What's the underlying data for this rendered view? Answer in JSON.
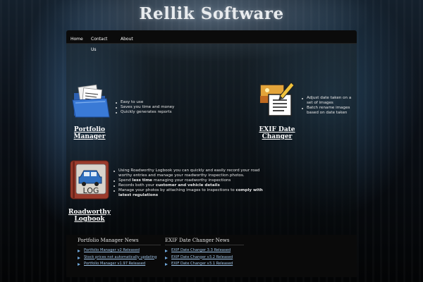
{
  "site": {
    "logo": "Rellik Software"
  },
  "nav": {
    "items": [
      {
        "label": "Home"
      },
      {
        "label": "Contact Us"
      },
      {
        "label": "About"
      }
    ]
  },
  "products": {
    "portfolio": {
      "title": "Portfolio Manager",
      "features": [
        "Easy to use",
        "Saves you time and money",
        "Quickly generates reports"
      ]
    },
    "exif": {
      "title": "EXIF Date Changer",
      "features": [
        "Adjust date taken on a set of images",
        "Batch rename images based on date taken"
      ]
    },
    "roadworthy": {
      "title": "Roadworthy Logbook",
      "icon_text": "LOG",
      "features": [
        {
          "parts": [
            {
              "text": "Using Roadworthy Logbook you can quickly and easily record your road worthy entries and manage your roadworthy inspection photos."
            }
          ]
        },
        {
          "parts": [
            {
              "text": "Spend "
            },
            {
              "text": "less time",
              "bold": true
            },
            {
              "text": " managing your roadworthy inspections"
            }
          ]
        },
        {
          "parts": [
            {
              "text": "Records both your "
            },
            {
              "text": "customer and vehicle details",
              "bold": true
            }
          ]
        },
        {
          "parts": [
            {
              "text": "Manage your photos by attaching images to inspections to "
            },
            {
              "text": "comply with latest regulations",
              "bold": true
            }
          ]
        }
      ]
    }
  },
  "news": {
    "portfolio": {
      "heading": "Portfolio Manager News",
      "items": [
        "Portfolio Manager v2 Released",
        "Stock prices not automatically updating",
        "Portfolio Manager v1.97 Released"
      ]
    },
    "exif": {
      "heading": "EXIF Date Changer News",
      "items": [
        "EXIF Date Changer 3.3 Released",
        "EXIF Date Changer v3.2 Released",
        "EXIF Date Changer v3.1 Released"
      ]
    }
  },
  "colors": {
    "link": "#9fc3e6",
    "folder_blue": "#3a7ad6",
    "logbook_red": "#9b3b2c",
    "car_blue": "#2f6fbf"
  }
}
